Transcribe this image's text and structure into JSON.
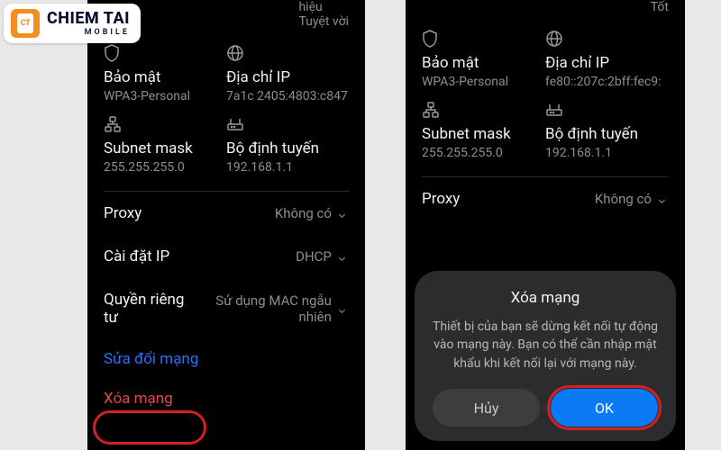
{
  "logo": {
    "main": "CHIEM TAI",
    "sub": "MOBILE",
    "mark": "CT"
  },
  "left": {
    "top_left": "",
    "top_right_a": "hiệu",
    "top_right_b": "Tuyệt vời",
    "security": {
      "label": "Bảo mật",
      "value": "WPA3-Personal"
    },
    "ip": {
      "label": "Địa chỉ IP",
      "value": "7a1c 2405:4803:c847"
    },
    "subnet": {
      "label": "Subnet mask",
      "value": "255.255.255.0"
    },
    "router": {
      "label": "Bộ định tuyến",
      "value": "192.168.1.1"
    },
    "proxy": {
      "label": "Proxy",
      "value": "Không có"
    },
    "ipset": {
      "label": "Cài đặt IP",
      "value": "DHCP"
    },
    "privacy": {
      "label": "Quyền riêng tư",
      "value": "Sử dụng MAC ngẫu nhiên"
    },
    "edit": "Sửa đổi mạng",
    "delete": "Xóa mạng"
  },
  "right": {
    "top_right": "Tốt",
    "security": {
      "label": "Bảo mật",
      "value": "WPA3-Personal"
    },
    "ip": {
      "label": "Địa chỉ IP",
      "value": "fe80::207c:2bff:fec9:"
    },
    "subnet": {
      "label": "Subnet mask",
      "value": "255.255.255.0"
    },
    "router": {
      "label": "Bộ định tuyến",
      "value": "192.168.1.1"
    },
    "proxy": {
      "label": "Proxy",
      "value": "Không có"
    },
    "dialog": {
      "title": "Xóa mạng",
      "body": "Thiết bị của bạn sẽ dừng kết nối tự động vào mạng này. Bạn có thể cần nhập mật khẩu khi kết nối lại với mạng này.",
      "cancel": "Hủy",
      "ok": "OK"
    }
  }
}
